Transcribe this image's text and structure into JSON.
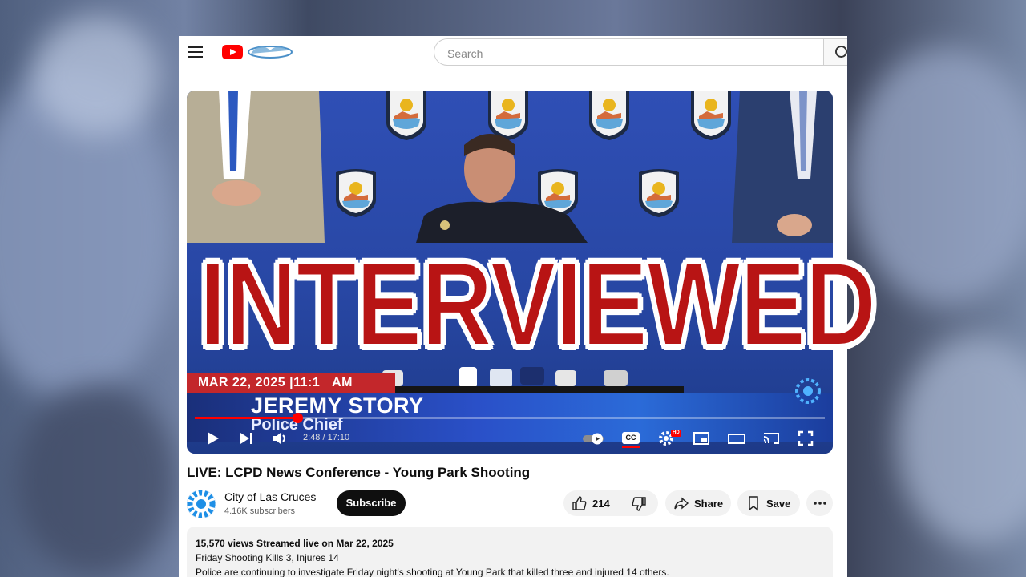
{
  "search": {
    "placeholder": "Search"
  },
  "overlay": {
    "text": "INTERVIEWED"
  },
  "player": {
    "lower_third_date": "MAR 22, 2025 |11:1",
    "lower_third_time_suffix": "AM",
    "lower_third_name": "JEREMY STORY",
    "lower_third_title": "Police Chief",
    "time_display": "2:48 / 17:10",
    "progress_fraction": 0.163,
    "cc_label": "CC",
    "hd_badge": "HD"
  },
  "video": {
    "title": "LIVE: LCPD News Conference - Young Park Shooting",
    "channel_name": "City of Las Cruces",
    "subscribers": "4.16K subscribers",
    "subscribe_label": "Subscribe",
    "likes": "214",
    "share_label": "Share",
    "save_label": "Save"
  },
  "description": {
    "stats": "15,570 views  Streamed live on Mar 22, 2025",
    "headline": "Friday Shooting Kills 3, Injures 14",
    "body": "Police are continuing to investigate Friday night's shooting at Young Park that killed three and injured 14 others."
  },
  "colors": {
    "accent_red": "#ff0000",
    "overlay_red": "#b81414",
    "police_blue": "#2b4cb0",
    "news_red": "#c3272b"
  },
  "icons": [
    "menu-icon",
    "youtube-logo",
    "search-icon",
    "play-icon",
    "next-icon",
    "volume-icon",
    "autoplay-toggle",
    "cc-icon",
    "settings-icon",
    "miniplayer-icon",
    "theater-icon",
    "cast-icon",
    "fullscreen-icon",
    "like-icon",
    "dislike-icon",
    "share-icon",
    "save-icon",
    "more-icon"
  ]
}
